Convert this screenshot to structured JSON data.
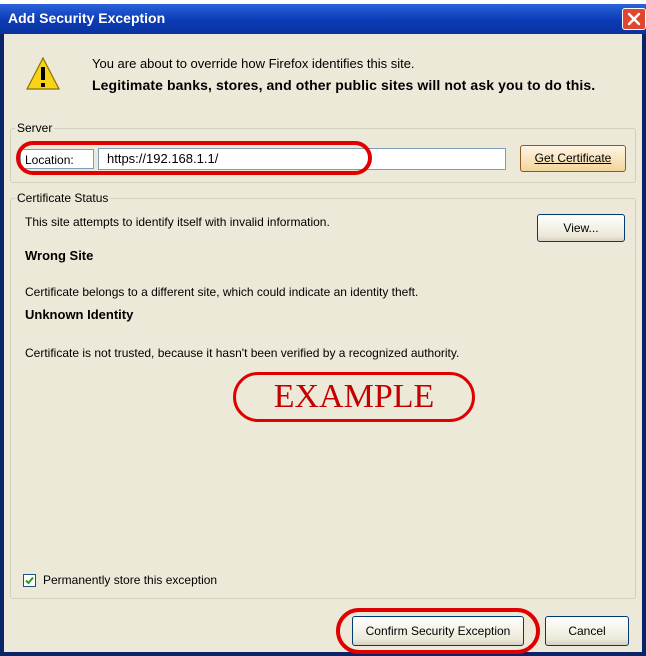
{
  "dialog": {
    "title": "Add Security Exception"
  },
  "intro": {
    "line1": "You are about to override how Firefox identifies this site.",
    "line2": "Legitimate banks, stores, and other public sites will not ask you to do this."
  },
  "server": {
    "legend": "Server",
    "location_label": "Location:",
    "location_value": "https://192.168.1.1/",
    "get_certificate_button": "Get Certificate"
  },
  "certificate_status": {
    "legend": "Certificate Status",
    "summary": "This site attempts to identify itself with invalid information.",
    "view_button": "View...",
    "sections": [
      {
        "heading": "Wrong Site",
        "text": "Certificate belongs to a different site, which could indicate an identity theft."
      },
      {
        "heading": "Unknown Identity",
        "text": "Certificate is not trusted, because it hasn't been verified by a recognized authority."
      }
    ]
  },
  "watermark": "EXAMPLE",
  "permanent_store": {
    "label": "Permanently store this exception",
    "checked": true
  },
  "buttons": {
    "confirm": "Confirm Security Exception",
    "cancel": "Cancel"
  },
  "colors": {
    "annotation_red": "#e00000",
    "titlebar_blue": "#0b3bb5",
    "dialog_bg": "#ece9d8"
  },
  "icons": {
    "warning": "warning-icon",
    "close": "close-icon",
    "checkmark": "checkmark-icon"
  }
}
